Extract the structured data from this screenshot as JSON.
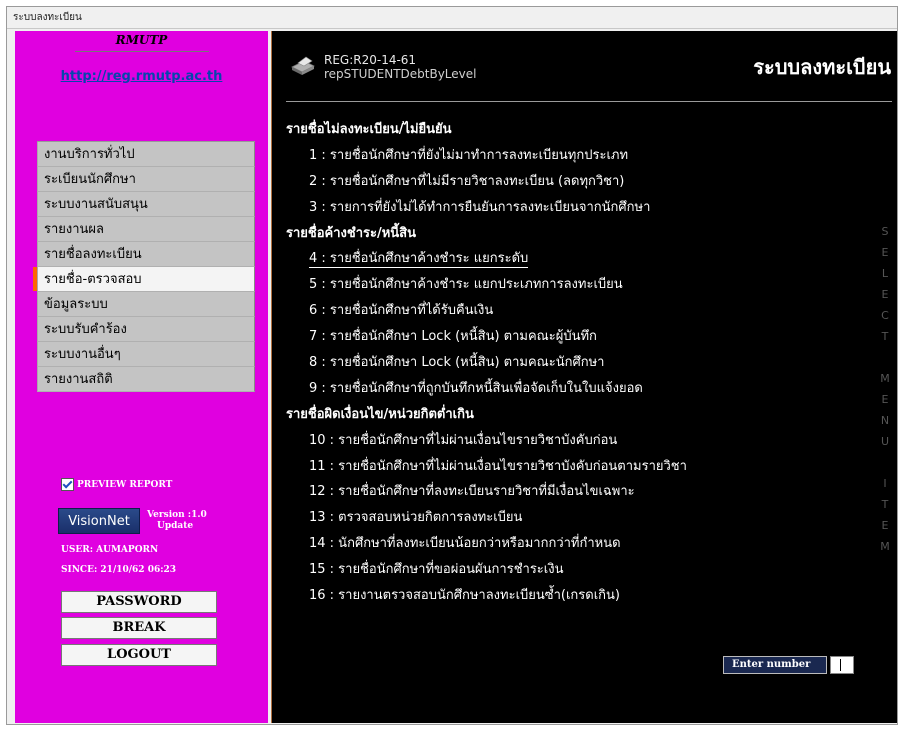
{
  "window": {
    "title": "ระบบลงทะเบียน"
  },
  "sidebar": {
    "brand": "RMUTP",
    "url": "http://reg.rmutp.ac.th",
    "menu": [
      "งานบริการทั่วไป",
      "ระเบียนนักศึกษา",
      "ระบบงานสนับสนุน",
      "รายงานผล",
      "รายชื่อลงทะเบียน",
      "รายชื่อ-ตรวจสอบ",
      "ข้อมูลระบบ",
      "ระบบรับคำร้อง",
      "ระบบงานอื่นๆ",
      "รายงานสถิติ"
    ],
    "active_index": 5,
    "preview_label": "PREVIEW REPORT",
    "preview_checked": true,
    "logo_text": "VisionNet",
    "version_line1": "Version :1.0",
    "version_line2": "Update",
    "user_line": "USER: AUMAPORN",
    "since_line": "SINCE: 21/10/62 06:23",
    "buttons": {
      "password": "PASSWORD",
      "break": "BREAK",
      "logout": "LOGOUT"
    }
  },
  "header": {
    "code": "REG:R20-14-61",
    "report": "repSTUDENTDebtByLevel",
    "title": "ระบบลงทะเบียน"
  },
  "sections": [
    {
      "title": "รายชื่อไม่ลงทะเบียน/ไม่ยืนยัน",
      "items": [
        "1 : รายชื่อนักศึกษาที่ยังไม่มาทำการลงทะเบียนทุกประเภท",
        "2 : รายชื่อนักศึกษาที่ไม่มีรายวิชาลงทะเบียน (ลดทุกวิชา)",
        "3 : รายการที่ยังไม่ได้ทำการยืนยันการลงทะเบียนจากนักศึกษา"
      ]
    },
    {
      "title": "รายชื่อค้างชำระ/หนี้สิน",
      "items": [
        "4 : รายชื่อนักศึกษาค้างชำระ แยกระดับ",
        "5 : รายชื่อนักศึกษาค้างชำระ แยกประเภทการลงทะเบียน",
        "6 : รายชื่อนักศึกษาที่ได้รับคืนเงิน",
        "7 : รายชื่อนักศึกษา Lock (หนี้สิน) ตามคณะผู้บันทึก",
        "8 : รายชื่อนักศึกษา Lock (หนี้สิน) ตามคณะนักศึกษา",
        "9 : รายชื่อนักศึกษาที่ถูกบันทึกหนี้สินเพื่อจัดเก็บในใบแจ้งยอด"
      ]
    },
    {
      "title": "รายชื่อผิดเงื่อนไข/หน่วยกิตต่ำเกิน",
      "items": [
        "10 : รายชื่อนักศึกษาที่ไม่ผ่านเงื่อนไขรายวิชาบังคับก่อน",
        "11 : รายชื่อนักศึกษาที่ไม่ผ่านเงื่อนไขรายวิชาบังคับก่อนตามรายวิชา",
        "12 : รายชื่อนักศึกษาที่ลงทะเบียนรายวิชาที่มีเงื่อนไขเฉพาะ",
        "13 : ตรวจสอบหน่วยกิตการลงทะเบียน",
        "14 : นักศึกษาที่ลงทะเบียนน้อยกว่าหรือมากกว่าที่กำหนด",
        "15 : รายชื่อนักศึกษาที่ขอผ่อนผันการชำระเงิน",
        "16 : รายงานตรวจสอบนักศึกษาลงทะเบียนซ้ำ(เกรดเกิน)"
      ]
    }
  ],
  "selected_item": 4,
  "side_label": "SELECT MENU ITEM",
  "enter": {
    "label": "Enter number",
    "value": ""
  },
  "colors": {
    "sidebar": "#e000e0",
    "main": "#000000",
    "active_marker": "#ff6600",
    "link": "#0645ad"
  }
}
